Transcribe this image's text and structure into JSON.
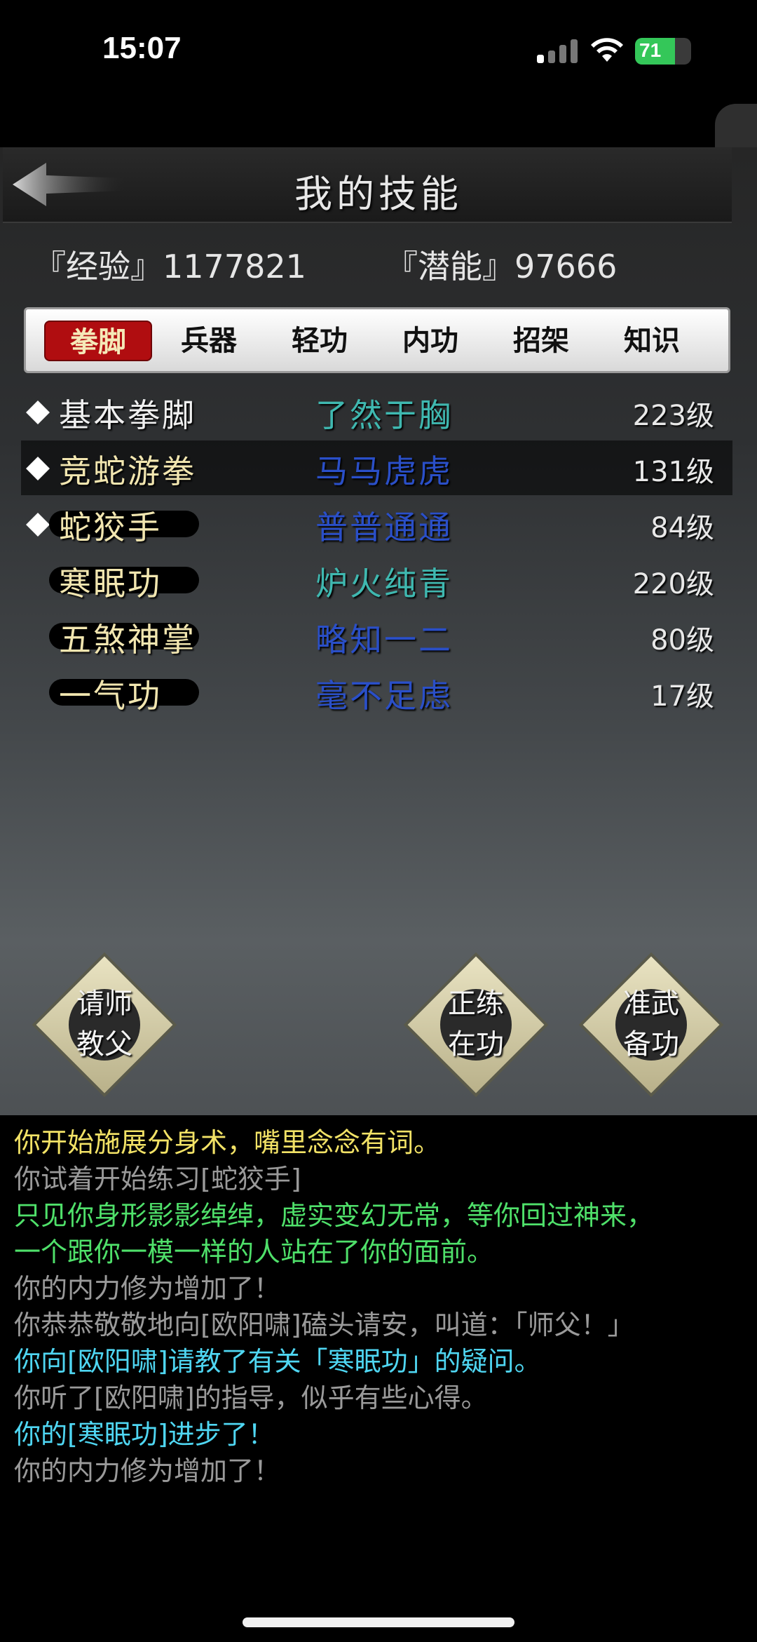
{
  "status_bar": {
    "time": "15:07",
    "battery": "71",
    "battery_level": 0.71
  },
  "side_handle": {
    "glyph": "❮"
  },
  "header": {
    "title": "我的技能",
    "back_icon": "back-arrow-icon"
  },
  "stats": {
    "exp_label": "『经验』1177821",
    "pot_label": "『潜能』97666"
  },
  "tabs": [
    {
      "label": "拳脚",
      "active": true
    },
    {
      "label": "兵器"
    },
    {
      "label": "轻功"
    },
    {
      "label": "内功"
    },
    {
      "label": "招架"
    },
    {
      "label": "知识"
    }
  ],
  "skills": [
    {
      "name": "基本拳脚",
      "rank": "了然于胸",
      "level": "223级",
      "marked": true,
      "rank_color": "#3fb8b0"
    },
    {
      "name": "竞蛇游拳",
      "rank": "马马虎虎",
      "level": "131级",
      "marked": true,
      "selected": true,
      "rank_color": "#2a4fc8"
    },
    {
      "name": "蛇狡手",
      "rank": "普普通通",
      "level": "84级",
      "marked": true,
      "rank_color": "#2a4fc8"
    },
    {
      "name": "寒眠功",
      "rank": "炉火纯青",
      "level": "220级",
      "rank_color": "#3fb8b0"
    },
    {
      "name": "五煞神掌",
      "rank": "略知一二",
      "level": "80级",
      "rank_color": "#2a4fc8"
    },
    {
      "name": "一气功",
      "rank": "毫不足虑",
      "level": "17级",
      "rank_color": "#2a4fc8"
    }
  ],
  "buttons": {
    "teacher": {
      "line1": "请师",
      "line2": "教父"
    },
    "practice": {
      "line1": "正练",
      "line2": "在功"
    },
    "prepare": {
      "line1": "准武",
      "line2": "备功"
    }
  },
  "log": [
    {
      "text": "你开始施展分身术，嘴里念念有词。",
      "color": "#f2e266"
    },
    {
      "text": "你试着开始练习[蛇狡手]",
      "color": "#9a9a9a"
    },
    {
      "text": "只见你身形影影绰绰，虚实变幻无常，等你回过神来，",
      "color": "#4fe06a"
    },
    {
      "text": "一个跟你一模一样的人站在了你的面前。",
      "color": "#4fe06a"
    },
    {
      "text": "你的内力修为增加了！",
      "color": "#9a9a9a"
    },
    {
      "text": "你恭恭敬敬地向[欧阳啸]磕头请安，叫道：「师父！」",
      "color": "#9a9a9a"
    },
    {
      "text": "你向[欧阳啸]请教了有关「寒眠功」的疑问。",
      "color": "#4fd6f2"
    },
    {
      "text": "你听了[欧阳啸]的指导，似乎有些心得。",
      "color": "#9a9a9a"
    },
    {
      "text": "你的[寒眠功]进步了！",
      "color": "#4fd6f2"
    },
    {
      "text": "你的内力修为增加了！",
      "color": "#9a9a9a"
    }
  ]
}
